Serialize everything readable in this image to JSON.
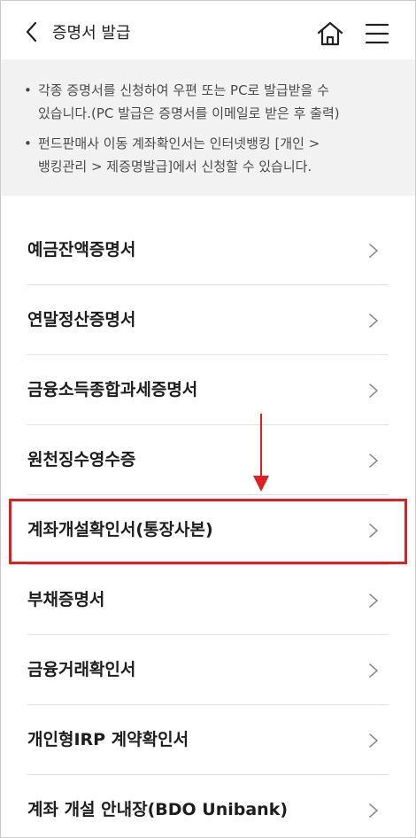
{
  "header": {
    "title": "증명서 발급",
    "back_icon": "chevron-left-icon",
    "home_icon": "home-icon",
    "menu_icon": "hamburger-menu-icon"
  },
  "notice": {
    "bullet": "•",
    "items": [
      {
        "line1": "각종 증명서를 신청하여 우편 또는 PC로 발급받을 수",
        "line2": "있습니다.(PC 발급은 증명서를 이메일로 받은 후 출력)"
      },
      {
        "line1": "펀드판매사 이동 계좌확인서는 인터넷뱅킹 [개인 >",
        "line2": "뱅킹관리 > 제증명발급]에서 신청할 수 있습니다."
      }
    ]
  },
  "menu": {
    "items": [
      {
        "label": "예금잔액증명서"
      },
      {
        "label": "연말정산증명서"
      },
      {
        "label": "금융소득종합과세증명서"
      },
      {
        "label": "원천징수영수증"
      },
      {
        "label": "계좌개설확인서(통장사본)"
      },
      {
        "label": "부채증명서"
      },
      {
        "label": "금융거래확인서"
      },
      {
        "label": "개인형IRP 계약확인서"
      },
      {
        "label": "계좌 개설 안내장(BDO Unibank)"
      }
    ],
    "highlighted_index": 4
  },
  "colors": {
    "highlight": "#e02020",
    "notice_bg": "#f2f2f2"
  }
}
